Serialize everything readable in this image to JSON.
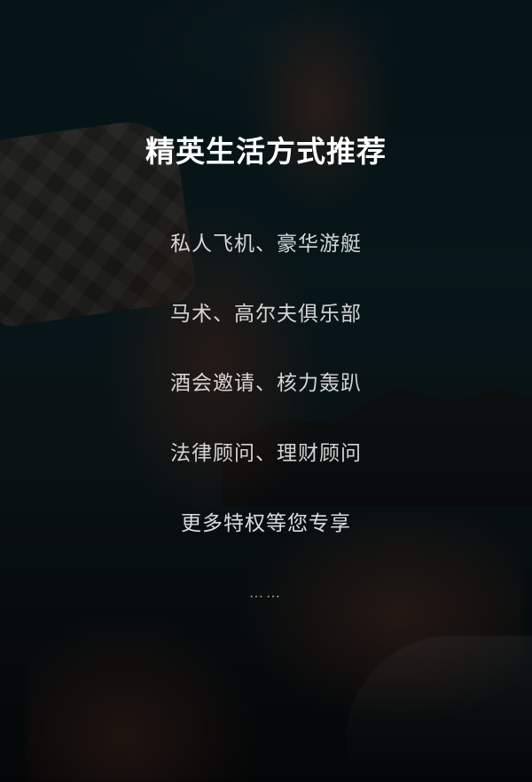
{
  "hero": {
    "title": "精英生活方式推荐",
    "items": [
      "私人飞机、豪华游艇",
      "马术、高尔夫俱乐部",
      "酒会邀请、核力轰趴",
      "法律顾问、理财顾问",
      "更多特权等您专享"
    ],
    "ellipsis": "……"
  },
  "colors": {
    "overlay": "rgba(0,0,0,0.55)",
    "title": "#ffffff",
    "item_text": "#d1d1d1"
  }
}
